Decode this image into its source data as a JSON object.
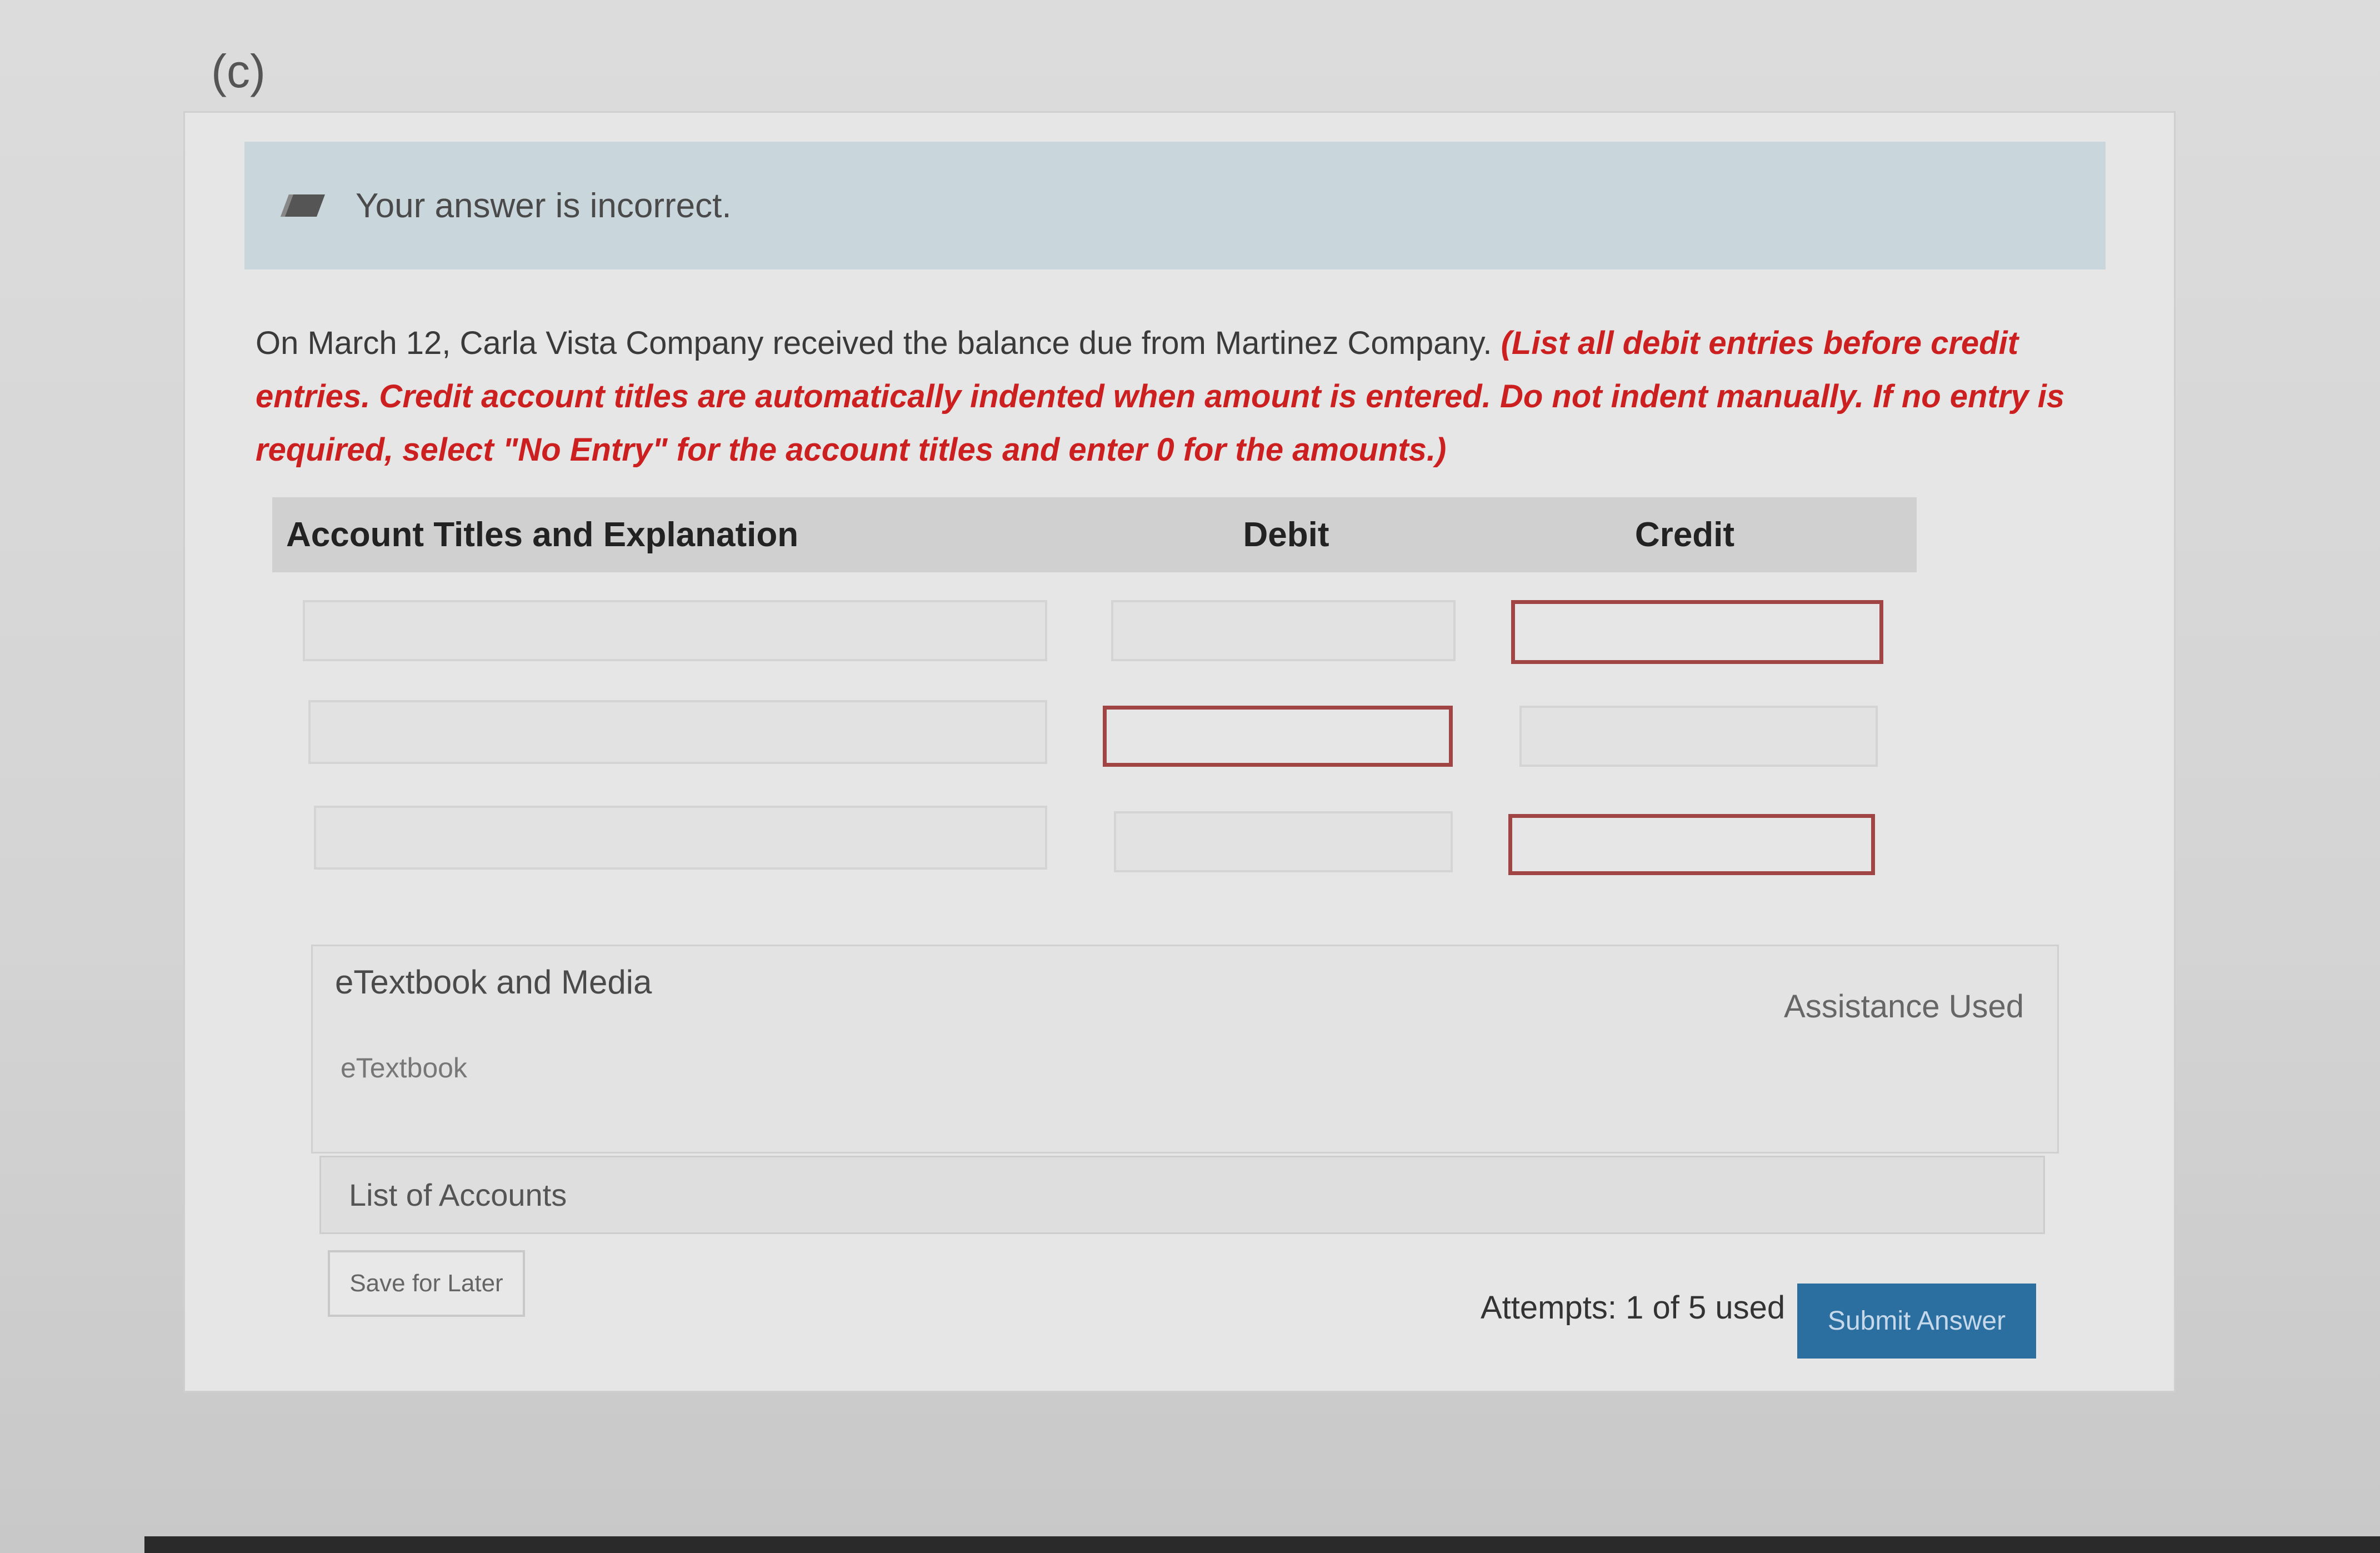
{
  "part_label": "(c)",
  "feedback": {
    "message": "Your answer is incorrect.",
    "icon": "pencil-icon"
  },
  "question": {
    "text": "On March 12, Carla Vista Company received the balance due from Martinez Company. ",
    "instructions": "(List all debit entries before credit entries. Credit account titles are automatically indented when amount is entered. Do not indent manually. If no entry is required, select \"No Entry\" for the account titles and enter 0 for the amounts.)"
  },
  "table": {
    "headers": {
      "account": "Account Titles and Explanation",
      "debit": "Debit",
      "credit": "Credit"
    },
    "rows": [
      {
        "account": "",
        "debit": "",
        "credit": "",
        "error": "credit"
      },
      {
        "account": "",
        "debit": "",
        "credit": "",
        "error": "debit"
      },
      {
        "account": "",
        "debit": "",
        "credit": "",
        "error": "credit"
      }
    ]
  },
  "media": {
    "title": "eTextbook and Media",
    "etextbook_link": "eTextbook",
    "assistance": "Assistance Used"
  },
  "list_of_accounts": "List of Accounts",
  "buttons": {
    "save": "Save for Later",
    "submit": "Submit Answer"
  },
  "attempts": "Attempts: 1 of 5 used",
  "colors": {
    "error_red": "#cc2020",
    "submit_blue": "#2b6ea0",
    "banner": "#c9d6dc"
  }
}
